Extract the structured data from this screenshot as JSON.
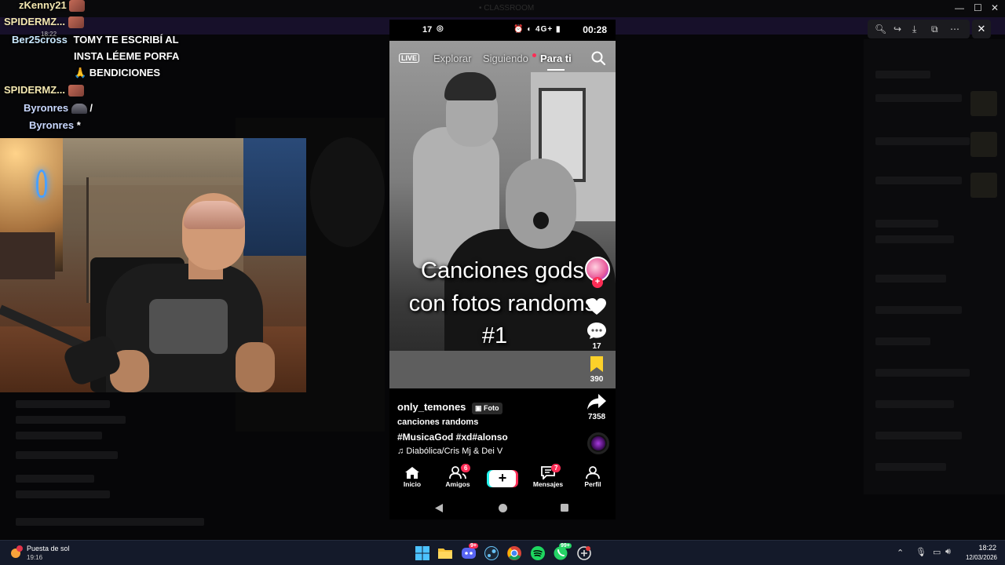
{
  "window": {
    "title": "• CLASSROOM",
    "controls": [
      "—",
      "☐",
      "✕"
    ]
  },
  "chat": {
    "timestamp": "18:22",
    "messages": [
      {
        "user": "zKenny21",
        "text": "",
        "emote": true
      },
      {
        "user": "SPIDERMZ...",
        "text": "",
        "emote": true
      },
      {
        "user": "Ber25cross",
        "text": "TOMY TE ESCRIBÍ AL"
      },
      {
        "user": "",
        "text": "INSTA LÉEME PORFA"
      },
      {
        "user": "",
        "text": "🙏 BENDICIONES"
      },
      {
        "user": "SPIDERMZ...",
        "text": "",
        "emote": true
      },
      {
        "user": "Byronres",
        "text": "/",
        "emote_dark": true
      },
      {
        "user": "Byronres",
        "text": "*"
      }
    ]
  },
  "phone": {
    "status": {
      "left": "17",
      "time": "00:28",
      "icons": "⏰ ◐ 4G+ ▮"
    },
    "top_nav": {
      "live": "LIVE",
      "explore": "Explorar",
      "following": "Siguiendo",
      "for_you": "Para ti"
    },
    "caption": {
      "line1": "Canciones gods",
      "line2": "con fotos randoms",
      "line3": "#1"
    },
    "actions": {
      "comments": "17",
      "saves": "390",
      "shares": "7358"
    },
    "info": {
      "author": "only_temones",
      "badge": "Foto",
      "description": "canciones randoms",
      "tags": "#MusicaGod #xd#alonso",
      "music": "Diabólica/Cris Mj & Dei V"
    },
    "bottom_nav": {
      "home": "Inicio",
      "friends": "Amigos",
      "friends_badge": "6",
      "messages": "Mensajes",
      "messages_badge": "7",
      "profile": "Perfil",
      "create": "+"
    }
  },
  "taskbar": {
    "weather_title": "Puesta de sol",
    "weather_sub": "19:16",
    "time": "18:22",
    "date": "12/03/2026",
    "discord_badge": "9+",
    "whatsapp_badge": "99+"
  },
  "colors": {
    "tiktok_red": "#fe2c55",
    "tiktok_cyan": "#25f4ee",
    "chat_name": "#f3e7b0",
    "taskbar": "#141a2a"
  }
}
